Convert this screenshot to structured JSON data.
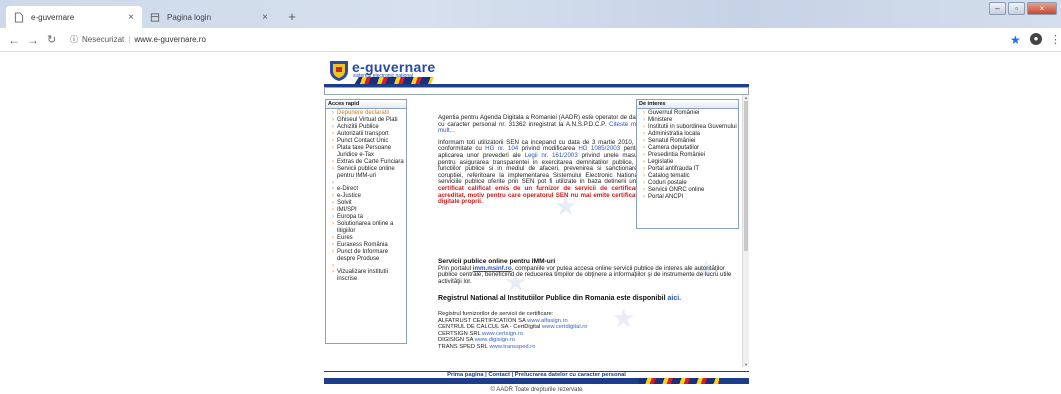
{
  "browser": {
    "tabs": [
      {
        "title": "e-guvernare",
        "close": "×"
      },
      {
        "title": "Pagina login",
        "close": "×"
      }
    ],
    "new_tab": "+",
    "address": {
      "security": "Nesecurizat",
      "url": "www.e-guvernare.ro"
    },
    "window_controls": [
      "–",
      "▫",
      "×"
    ]
  },
  "site": {
    "logo_text": "e-guvernare",
    "logo_sub": "sistemul electronic national",
    "left_panel": {
      "title": "Acces rapid",
      "groups": [
        [
          "Depunere declaratii",
          "Ghiseul Virtual de Plati",
          "Achizitii Publice",
          "Autorizatii transport",
          "Punct Contact Unic",
          "Plata taxe Persoane Juridice e-Tax",
          "Extras de Carte Funciara",
          "Servicii publice online pentru IMM-uri"
        ],
        [
          "e-Direct",
          "e-Justice",
          "Solvit",
          "IMI/SPI",
          "Europa ta",
          "Solutionarea online a litigiilor",
          "Eures",
          "Euraxess România",
          "Punct de Informare despre Produse"
        ],
        [
          "Vizualizare institutii inscrise"
        ]
      ]
    },
    "right_panel": {
      "title": "De interes",
      "items": [
        "Guvernul României",
        "Ministere",
        "Institutii in subordinea Guvernului",
        "Administratia locala",
        "Senatul României",
        "Camera deputatilor",
        "Presedintia României",
        "Legislatie",
        "Portal antifrauda IT",
        "Catalog tematic",
        "Coduri postale",
        "Servicii ONRC online",
        "Portal ANCPI"
      ]
    },
    "intro": "Agentia pentru Agenda Digitala a Romaniei (AADR) este operator de date cu caracter personal nr. 31362 inregistrat la A.N.S.P.D.C.P.",
    "intro_link": "Citeste mai mult...",
    "notice_part1": "Informam toti utilizatorii SEN ca incepand cu data de 3 martie 2010, in conformitate cu",
    "notice_link1": "HG nr. 104",
    "notice_part2": "privind modificarea",
    "notice_link2": "HG 1085/2003",
    "notice_part3": "pentru aplicarea unor prevederi ale",
    "notice_link3": "Legii nr. 161/2003",
    "notice_part4": "privind unele masuri pentru asigurarea transparentei in exercitarea demnitatilor publice, a functiilor publice si in mediul de afaceri, prevenirea si sanctionarea coruptiei, referitoare la implementarea Sistemului Electronic National, serviciile publice oferite prin SEN pot fi utilizate in baza detinerii unui",
    "notice_red": "certificat calificat emis de un furnizor de servicii de certificare acreditat, motiv pentru care operatorul SEN nu mai emite certificate digitale proprii.",
    "imm_title": "Servicii publice online pentru IMM-uri",
    "imm_pre": "Prin portalul",
    "imm_link": "imm.msinf.ro",
    "imm_post": ", companiile vor putea accesa online servicii publice de interes ale autorităţilor publice centrale, beneficiind de reducerea timpilor de obţinere a informaţiilor şi de instrumente de lucru utile activităţii lor.",
    "registru_text": "Registrul National al Institutiilor Publice din Romania este disponibil",
    "registru_link": "aici.",
    "furnizori_title": "Registrul furnizorilor de servicii de certificare:",
    "furnizori": [
      {
        "name": "ALFATRUST CERTIFICATION SA",
        "url": "www.alfasign.ro"
      },
      {
        "name": "CENTRUL DE CALCUL SA - CertDigital",
        "url": "www.certdigital.ro"
      },
      {
        "name": "CERTSIGN SRL",
        "url": "www.certsign.ro"
      },
      {
        "name": "DIGISIGN SA",
        "url": "www.digisign.ro"
      },
      {
        "name": "TRANS SPED SRL",
        "url": "www.transsped.ro"
      }
    ],
    "footer_links": [
      "Prima pagina",
      "Contact",
      "Prelucrarea datelor cu caracter personal"
    ],
    "footer_sep": " | ",
    "copyright": "© AADR Toate drepturile rezervate"
  }
}
